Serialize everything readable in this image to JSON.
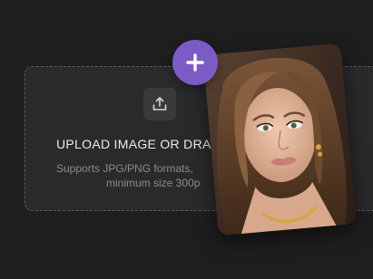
{
  "upload": {
    "title": "UPLOAD IMAGE OR DRA",
    "formats_line": "Supports JPG/PNG formats,",
    "size_line": "minimum size 300p"
  },
  "icons": {
    "upload": "upload-icon",
    "add": "plus-icon"
  },
  "colors": {
    "background": "#1e1e1f",
    "dropzone": "#2a2a2c",
    "accent": "#7c5cc4",
    "title_text": "#ececec",
    "muted_text": "#8b8b8e"
  }
}
